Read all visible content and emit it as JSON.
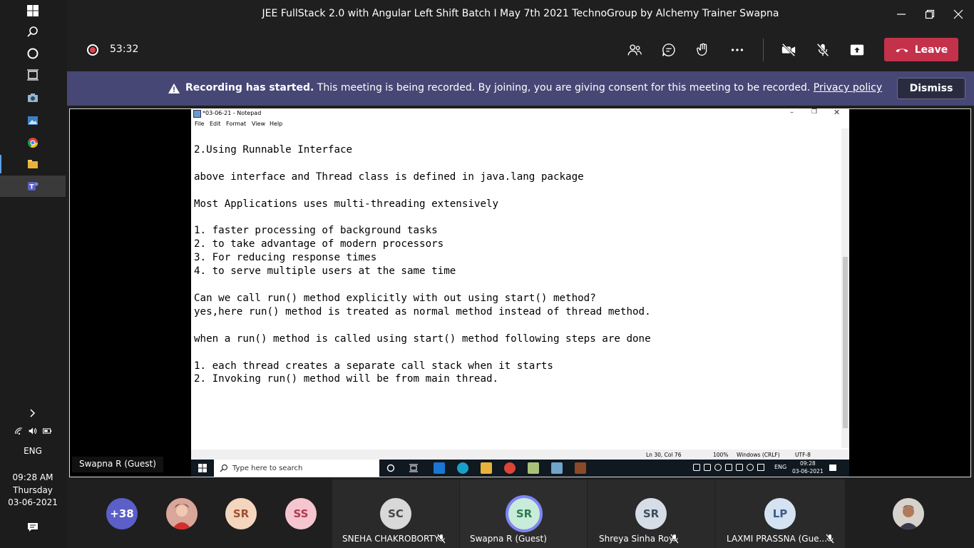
{
  "window": {
    "title": "JEE FullStack 2.0 with Angular Left Shift Batch I May 7th 2021 TechnoGroup by Alchemy Trainer Swapna"
  },
  "toolbar": {
    "timer": "53:32",
    "leave_label": "Leave"
  },
  "banner": {
    "strong": "Recording has started.",
    "message": " This meeting is being recorded. By joining, you are giving consent for this meeting to be recorded. ",
    "link": "Privacy policy",
    "dismiss_label": "Dismiss"
  },
  "system_tray": {
    "language": "ENG",
    "time": "09:28 AM",
    "day": "Thursday",
    "date": "03-06-2021"
  },
  "presenter": {
    "name": "Swapna R (Guest)"
  },
  "notepad": {
    "title": "*03-06-21 - Notepad",
    "menu": [
      "File",
      "Edit",
      "Format",
      "View",
      "Help"
    ],
    "lines": [
      "2.Using Runnable Interface",
      "",
      "above interface and Thread class is defined in java.lang package",
      "",
      "Most Applications uses multi-threading extensively",
      "",
      "1. faster processing of background tasks",
      "2. to take advantage of modern processors",
      "3. For reducing response times",
      "4. to serve multiple users at the same time",
      "",
      "Can we call run() method explicitly with out using start() method?",
      "yes,here run() method is treated as normal method instead of thread method.",
      "",
      "when a run() method is called using start() method following steps are done",
      "",
      "1. each thread creates a separate call stack when it starts",
      "2. Invoking run() method will be from main thread."
    ],
    "status": {
      "position": "Ln 30, Col 76",
      "zoom": "100%",
      "line_ending": "Windows (CRLF)",
      "encoding": "UTF-8"
    }
  },
  "inner_taskbar": {
    "search_placeholder": "Type here to search",
    "language": "ENG",
    "time": "09:28",
    "date": "03-06-2021"
  },
  "participants": {
    "more_count": "+38",
    "items": [
      {
        "initials": "SR",
        "color": "#f4d6bf"
      },
      {
        "initials": "SS",
        "color": "#f5c6cf"
      },
      {
        "initials": "SC",
        "name": "SNEHA CHAKROBORTY",
        "color": "#d8d8d8"
      },
      {
        "initials": "SR",
        "name": "Swapna R (Guest)",
        "color": "#c8ecd9"
      },
      {
        "initials": "SR",
        "name": "Shreya Sinha Roy",
        "color": "#d6dde6"
      },
      {
        "initials": "LP",
        "name": "LAXMI PRASSNA (Gue...",
        "color": "#d5e2f2"
      }
    ]
  }
}
